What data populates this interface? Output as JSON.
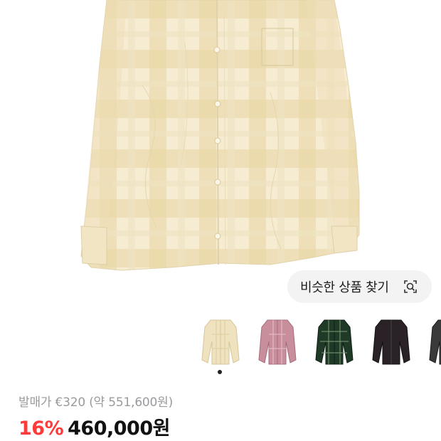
{
  "product": {
    "image_alt": "cream plaid long-sleeve shirt",
    "similar_button_label": "비슷한 상품 찾기",
    "thumbnails": [
      {
        "name": "cream-plaid",
        "color": "#efe2bf"
      },
      {
        "name": "pink-plaid",
        "color": "#c98e9c"
      },
      {
        "name": "green-plaid",
        "color": "#1f3a26"
      },
      {
        "name": "black",
        "color": "#2a2226"
      },
      {
        "name": "charcoal",
        "color": "#3a3a3a"
      }
    ],
    "active_thumbnail_index": 0
  },
  "pricing": {
    "original_price_text": "발매가 €320 (약 551,600원)",
    "discount_text": "16%",
    "sale_price_text": "460,000원"
  },
  "colors": {
    "discount": "#ff3a3a",
    "muted_text": "#9a9a9e",
    "button_bg": "#f3f3f4"
  }
}
